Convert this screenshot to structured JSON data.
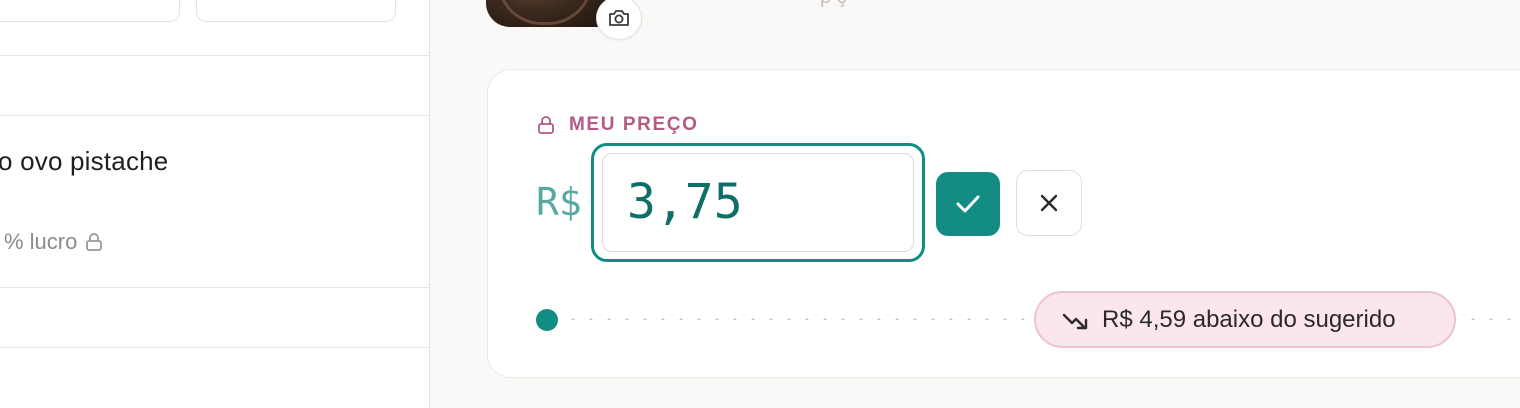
{
  "product": {
    "name": "o ovo pistache",
    "meta": "% lucro"
  },
  "top": {
    "faint_text": "p     ç"
  },
  "price_card": {
    "label": "MEU PREÇO",
    "currency": "R$",
    "value": "3,75",
    "slider_position": 0,
    "badge_text": "R$ 4,59 abaixo do sugerido"
  },
  "icons": {
    "lock": "lock-icon",
    "camera": "camera-icon",
    "check": "check-icon",
    "close": "close-icon",
    "trend_down": "trending-down-icon"
  },
  "colors": {
    "accent": "#138c84",
    "label_pink": "#b35a86",
    "badge_bg": "#fbe6ef"
  }
}
